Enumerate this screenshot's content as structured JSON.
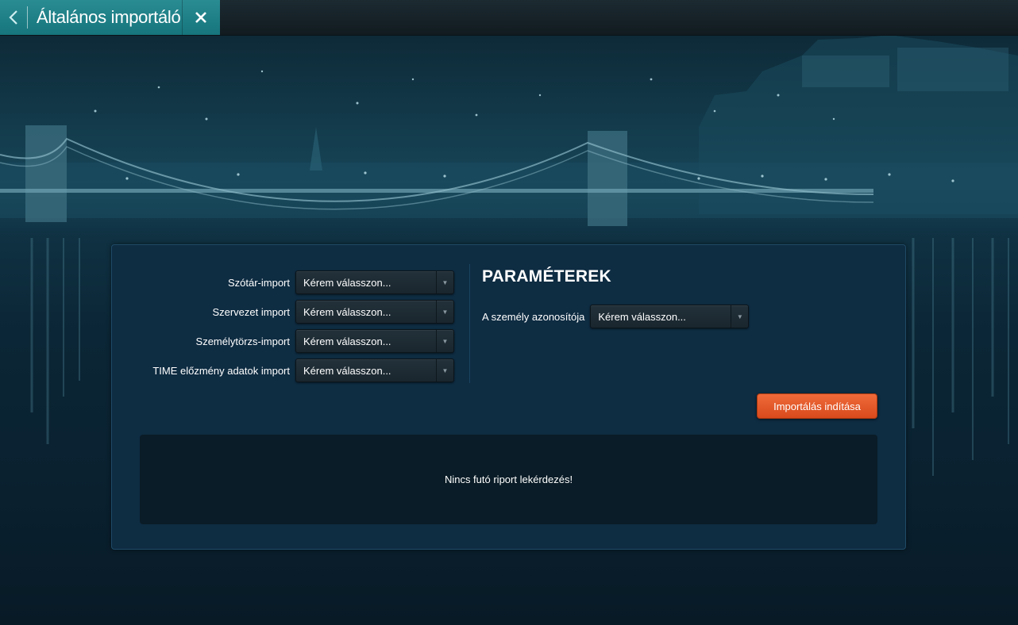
{
  "window": {
    "title": "Általános importáló"
  },
  "imports": [
    {
      "label": "Szótár-import",
      "value": "Kérem válasszon..."
    },
    {
      "label": "Szervezet import",
      "value": "Kérem válasszon..."
    },
    {
      "label": "Személytörzs-import",
      "value": "Kérem válasszon..."
    },
    {
      "label": "TIME előzmény adatok import",
      "value": "Kérem válasszon..."
    }
  ],
  "params": {
    "title": "PARAMÉTEREK",
    "person_id_label": "A személy azonosítója",
    "person_id_value": "Kérem válasszon..."
  },
  "actions": {
    "start_import": "Importálás indítása"
  },
  "status": {
    "message": "Nincs futó riport lekérdezés!"
  },
  "colors": {
    "accent": "#1f8088",
    "button": "#e45a28",
    "panel": "#0e2c42"
  },
  "icons": [
    "chevron-left-icon",
    "close-icon",
    "dropdown-arrow-icon"
  ]
}
